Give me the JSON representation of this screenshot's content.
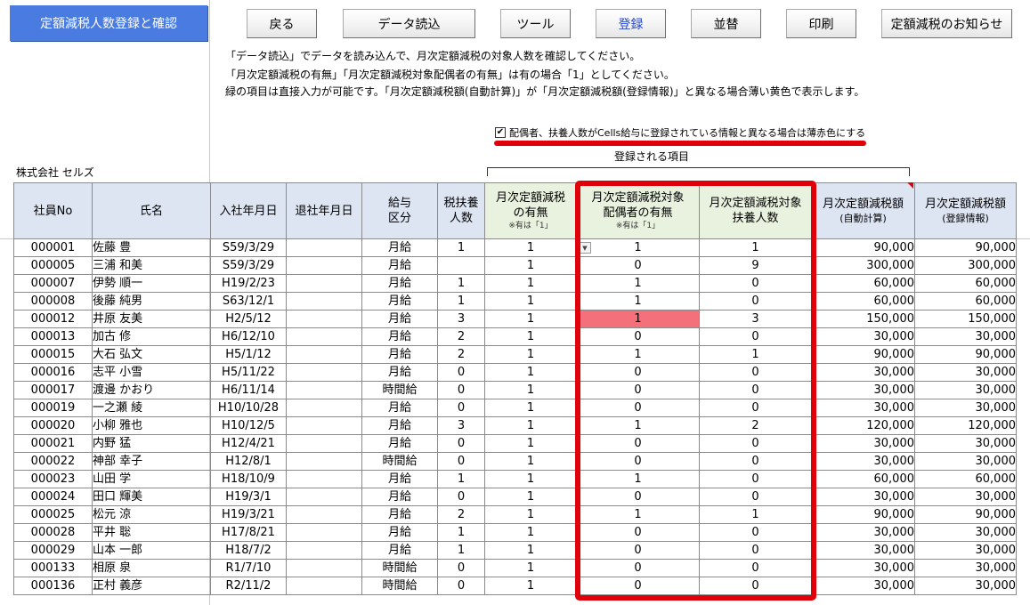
{
  "app": {
    "title": "定額減税人数登録と確認",
    "company": "株式会社 セルズ"
  },
  "toolbar": {
    "back": "戻る",
    "load": "データ読込",
    "tools": "ツール",
    "register": "登録",
    "sort": "並替",
    "print": "印刷",
    "notice": "定額減税のお知らせ"
  },
  "instructions": [
    "「データ読込」でデータを読み込んで、月次定額減税の対象人数を確認してください。",
    "「月次定額減税の有無」「月次定額減税対象配偶者の有無」は有の場合「1」としてください。",
    "緑の項目は直接入力が可能です。「月次定額減税額(自動計算)」が「月次定額減税額(登録情報)」と異なる場合薄い黄色で表示します。"
  ],
  "checkbox": {
    "label": "配偶者、扶養人数がCells給与に登録されている情報と異なる場合は薄赤色にする",
    "checked": true,
    "mark": "✔"
  },
  "registered_items_label": "登録される項目",
  "table": {
    "headers": {
      "emp_no": "社員No",
      "name": "氏名",
      "join_date": "入社年月日",
      "leave_date": "退社年月日",
      "pay_type_1": "給与",
      "pay_type_2": "区分",
      "dependents_1": "税扶養",
      "dependents_2": "人数",
      "monthly_1": "月次定額減税",
      "monthly_2": "の有無",
      "monthly_note": "※有は「1」",
      "spouse_1": "月次定額減税対象",
      "spouse_2": "配偶者の有無",
      "spouse_note": "※有は「1」",
      "dep_count_1": "月次定額減税対象",
      "dep_count_2": "扶養人数",
      "auto_1": "月次定額減税額",
      "auto_2": "(自動計算)",
      "reg_1": "月次定額減税額",
      "reg_2": "(登録情報)"
    },
    "highlight_color": "#f4707a",
    "frame_color": "#e0000a",
    "rows": [
      {
        "no": "000001",
        "name": "佐藤 豊",
        "join": "S59/3/29",
        "leave": "",
        "pay": "月給",
        "deps": "1",
        "monthly": "1",
        "spouse": "1",
        "depcount": "1",
        "auto": "90,000",
        "reg": "90,000",
        "dropdown": true
      },
      {
        "no": "000005",
        "name": "三浦 和美",
        "join": "S59/3/29",
        "leave": "",
        "pay": "月給",
        "deps": "",
        "monthly": "1",
        "spouse": "0",
        "depcount": "9",
        "auto": "300,000",
        "reg": "300,000"
      },
      {
        "no": "000007",
        "name": "伊勢 順一",
        "join": "H19/2/23",
        "leave": "",
        "pay": "月給",
        "deps": "1",
        "monthly": "1",
        "spouse": "1",
        "depcount": "0",
        "auto": "60,000",
        "reg": "60,000"
      },
      {
        "no": "000008",
        "name": "後藤 純男",
        "join": "S63/12/1",
        "leave": "",
        "pay": "月給",
        "deps": "1",
        "monthly": "1",
        "spouse": "1",
        "depcount": "0",
        "auto": "60,000",
        "reg": "60,000"
      },
      {
        "no": "000012",
        "name": "井原 友美",
        "join": "H2/5/12",
        "leave": "",
        "pay": "月給",
        "deps": "3",
        "monthly": "1",
        "spouse": "1",
        "depcount": "3",
        "auto": "150,000",
        "reg": "150,000",
        "highlight": true
      },
      {
        "no": "000013",
        "name": "加古 修",
        "join": "H6/12/10",
        "leave": "",
        "pay": "月給",
        "deps": "2",
        "monthly": "1",
        "spouse": "0",
        "depcount": "0",
        "auto": "30,000",
        "reg": "30,000"
      },
      {
        "no": "000015",
        "name": "大石 弘文",
        "join": "H5/1/12",
        "leave": "",
        "pay": "月給",
        "deps": "2",
        "monthly": "1",
        "spouse": "1",
        "depcount": "1",
        "auto": "90,000",
        "reg": "90,000"
      },
      {
        "no": "000016",
        "name": "志平 小雪",
        "join": "H5/11/22",
        "leave": "",
        "pay": "月給",
        "deps": "0",
        "monthly": "1",
        "spouse": "0",
        "depcount": "0",
        "auto": "30,000",
        "reg": "30,000"
      },
      {
        "no": "000017",
        "name": "渡邊 かおり",
        "join": "H6/11/14",
        "leave": "",
        "pay": "時間給",
        "deps": "0",
        "monthly": "1",
        "spouse": "0",
        "depcount": "0",
        "auto": "30,000",
        "reg": "30,000"
      },
      {
        "no": "000019",
        "name": "一之瀬 綾",
        "join": "H10/10/28",
        "leave": "",
        "pay": "月給",
        "deps": "0",
        "monthly": "1",
        "spouse": "0",
        "depcount": "0",
        "auto": "30,000",
        "reg": "30,000"
      },
      {
        "no": "000020",
        "name": "小柳 雅也",
        "join": "H10/12/5",
        "leave": "",
        "pay": "月給",
        "deps": "3",
        "monthly": "1",
        "spouse": "1",
        "depcount": "2",
        "auto": "120,000",
        "reg": "120,000"
      },
      {
        "no": "000021",
        "name": "内野 猛",
        "join": "H12/4/21",
        "leave": "",
        "pay": "月給",
        "deps": "0",
        "monthly": "1",
        "spouse": "0",
        "depcount": "0",
        "auto": "30,000",
        "reg": "30,000"
      },
      {
        "no": "000022",
        "name": "神部 幸子",
        "join": "H12/8/1",
        "leave": "",
        "pay": "時間給",
        "deps": "0",
        "monthly": "1",
        "spouse": "0",
        "depcount": "0",
        "auto": "30,000",
        "reg": "30,000"
      },
      {
        "no": "000023",
        "name": "山田 学",
        "join": "H18/10/9",
        "leave": "",
        "pay": "月給",
        "deps": "1",
        "monthly": "1",
        "spouse": "1",
        "depcount": "0",
        "auto": "60,000",
        "reg": "60,000"
      },
      {
        "no": "000024",
        "name": "田口 輝美",
        "join": "H19/3/1",
        "leave": "",
        "pay": "月給",
        "deps": "0",
        "monthly": "1",
        "spouse": "0",
        "depcount": "0",
        "auto": "30,000",
        "reg": "30,000"
      },
      {
        "no": "000025",
        "name": "松元 涼",
        "join": "H19/3/21",
        "leave": "",
        "pay": "月給",
        "deps": "2",
        "monthly": "1",
        "spouse": "1",
        "depcount": "1",
        "auto": "90,000",
        "reg": "90,000"
      },
      {
        "no": "000028",
        "name": "平井 聡",
        "join": "H17/8/21",
        "leave": "",
        "pay": "月給",
        "deps": "1",
        "monthly": "1",
        "spouse": "0",
        "depcount": "0",
        "auto": "30,000",
        "reg": "30,000"
      },
      {
        "no": "000029",
        "name": "山本 一郎",
        "join": "H18/7/2",
        "leave": "",
        "pay": "月給",
        "deps": "1",
        "monthly": "1",
        "spouse": "0",
        "depcount": "0",
        "auto": "30,000",
        "reg": "30,000"
      },
      {
        "no": "000133",
        "name": "相原 泉",
        "join": "R1/7/10",
        "leave": "",
        "pay": "時間給",
        "deps": "0",
        "monthly": "1",
        "spouse": "0",
        "depcount": "0",
        "auto": "30,000",
        "reg": "30,000"
      },
      {
        "no": "000136",
        "name": "正村 義彦",
        "join": "R2/11/2",
        "leave": "",
        "pay": "時間給",
        "deps": "0",
        "monthly": "1",
        "spouse": "0",
        "depcount": "0",
        "auto": "30,000",
        "reg": "30,000"
      }
    ]
  }
}
